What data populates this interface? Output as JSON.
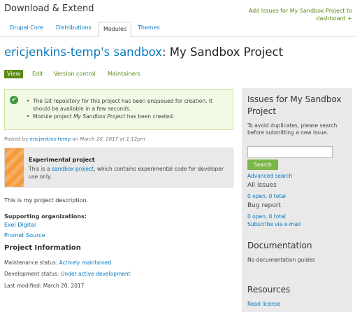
{
  "header": {
    "site_title": "Download & Extend",
    "add_issues": "Add Issues for My Sandbox Project to dashboard +"
  },
  "tabs": [
    {
      "label": "Drupal Core"
    },
    {
      "label": "Distributions"
    },
    {
      "label": "Modules",
      "active": true
    },
    {
      "label": "Themes"
    }
  ],
  "page": {
    "owner_link": "ericjenkins-temp's sandbox",
    "title_rest": ": My Sandbox Project"
  },
  "local_tabs": [
    {
      "label": "View",
      "active": true
    },
    {
      "label": "Edit"
    },
    {
      "label": "Version control"
    },
    {
      "label": "Maintainers"
    }
  ],
  "messages": {
    "line1": "The Git repository for this project has been enqueued for creation. It should be available in a few seconds.",
    "line2_pre": "Module project ",
    "line2_name": "My Sandbox Project",
    "line2_post": " has been created."
  },
  "submitted": {
    "prefix": "Posted by ",
    "author": "ericjenkins-temp",
    "on": " on ",
    "date": "March 20, 2017 at 1:12pm"
  },
  "experimental": {
    "title": "Experimental project",
    "text_pre": "This is a ",
    "link": "sandbox project",
    "text_post": ", which contains experimental code for developer use only."
  },
  "description": "This is my project description.",
  "supporting": {
    "heading": "Supporting organizations:",
    "orgs": [
      "Exel Digital",
      "Promet Source"
    ]
  },
  "project_info": {
    "heading": "Project Information",
    "maintenance_label": "Maintenance status: ",
    "maintenance_value": "Actively maintained",
    "development_label": "Development status: ",
    "development_value": "Under active development",
    "modified": "Last modified: March 20, 2017"
  },
  "sidebar": {
    "issues_title": "Issues for My Sandbox Project",
    "issues_hint": "To avoid duplicates, please search before submitting a new issue.",
    "search_button": "Search",
    "advanced_search": "Advanced search",
    "all_issues": "All issues",
    "all_open": "0 open",
    "all_total": "0 total",
    "bug_report": "Bug report",
    "bug_open": "0 open",
    "bug_total": "0 total",
    "subscribe": "Subscribe via e-mail",
    "documentation_title": "Documentation",
    "no_docs": "No documentation guides",
    "resources_title": "Resources",
    "read_license": "Read license"
  },
  "colors": {
    "link": "#0678be",
    "green_accent": "#5a8a14",
    "button_green": "#7ab648",
    "sidebar_bg": "#e9e9e9",
    "message_bg": "#f2fae5",
    "stripe_orange": "#f59a3c"
  }
}
